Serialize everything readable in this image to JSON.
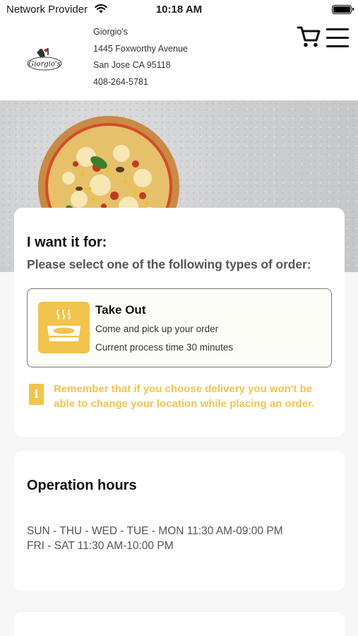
{
  "status_bar": {
    "carrier": "Network Provider",
    "time": "10:18 AM"
  },
  "header": {
    "store_name": "Giorgio's",
    "address_line1": "1445 Foxworthy Avenue",
    "address_line2": "San Jose CA 95118",
    "phone": "408-264-5781",
    "logo_text": "Giorgio's",
    "icons": [
      "cart-icon",
      "menu-icon"
    ]
  },
  "order": {
    "title": "I want it for:",
    "subtitle": "Please select one of the following types of order:",
    "option": {
      "title": "Take Out",
      "description": "Come and pick up your order",
      "process_time": "Current process time 30 minutes"
    },
    "notice": "Remember that if you choose delivery you won't be able to change your location while placing an order."
  },
  "hours": {
    "title": "Operation hours",
    "lines": [
      "SUN - THU - WED - TUE - MON  11:30 AM-09:00 PM",
      "FRI - SAT  11:30 AM-10:00 PM"
    ]
  },
  "colors": {
    "accent": "#f2c44e",
    "card_bg": "#ffffff",
    "page_bg": "#f6f6f6"
  }
}
